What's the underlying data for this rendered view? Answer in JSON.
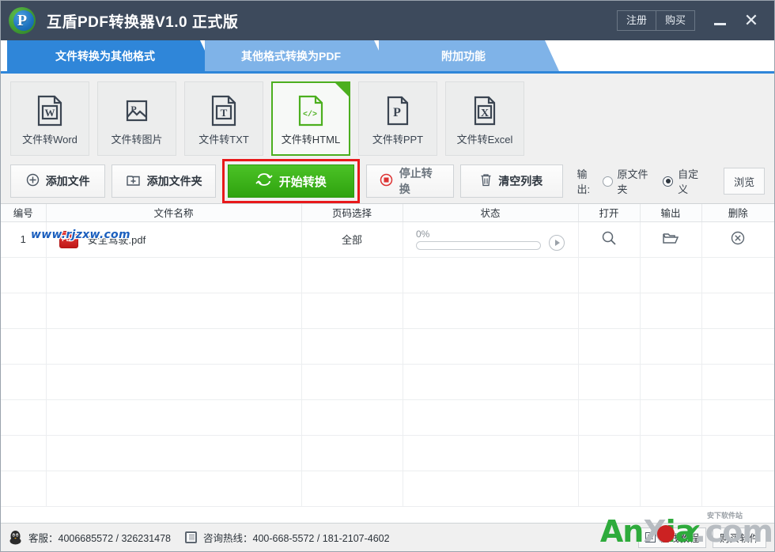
{
  "titlebar": {
    "app_title": "互盾PDF转换器V1.0 正式版",
    "logo_letter": "P",
    "register_label": "注册",
    "buy_label": "购买",
    "minimize_label": "—",
    "close_label": "✕"
  },
  "tabs": [
    {
      "label": "文件转换为其他格式",
      "active": true
    },
    {
      "label": "其他格式转换为PDF",
      "active": false
    },
    {
      "label": "附加功能",
      "active": false
    }
  ],
  "formats": [
    {
      "label": "文件转Word",
      "icon": "word-file-icon",
      "glyph": "W",
      "selected": false
    },
    {
      "label": "文件转图片",
      "icon": "image-file-icon",
      "glyph": "P",
      "selected": false
    },
    {
      "label": "文件转TXT",
      "icon": "txt-file-icon",
      "glyph": "T",
      "selected": false
    },
    {
      "label": "文件转HTML",
      "icon": "html-file-icon",
      "glyph": "</>",
      "selected": true
    },
    {
      "label": "文件转PPT",
      "icon": "ppt-file-icon",
      "glyph": "P",
      "selected": false
    },
    {
      "label": "文件转Excel",
      "icon": "excel-file-icon",
      "glyph": "X",
      "selected": false
    }
  ],
  "toolbar": {
    "add_file_label": "添加文件",
    "add_folder_label": "添加文件夹",
    "start_label": "开始转换",
    "stop_label": "停止转换",
    "clear_label": "清空列表",
    "output_label": "输出:",
    "output_option_source": "原文件夹",
    "output_option_custom": "自定义",
    "output_selected": "自定义",
    "browse_label": "浏览"
  },
  "watermark": {
    "site": "www.rjzxw.com",
    "brand_green": "An",
    "brand_gray_1": "X",
    "brand_gray_2": "ia",
    "brand_tail": ".com",
    "tiny_text": "安下软件站",
    "check": "✔"
  },
  "table": {
    "columns": [
      "编号",
      "文件名称",
      "页码选择",
      "状态",
      "打开",
      "输出",
      "删除"
    ],
    "rows": [
      {
        "index": "1",
        "filename": "安全驾驶.pdf",
        "file_type_badge": "PDF",
        "pages": "全部",
        "progress_text": "0%",
        "progress_value": 0,
        "open_icon": "search-icon",
        "output_icon": "folder-icon",
        "delete_icon": "close-circle-icon"
      }
    ],
    "empty_row_count": 7
  },
  "statusbar": {
    "support_label": "客服：4006685572 / 326231478",
    "hotline_label": "咨询热线：400-668-5572 / 181-2107-4602",
    "tutorial_label": "在线教程",
    "buy_software_label": "购买软件"
  },
  "colors": {
    "title_bar": "#3d4a5c",
    "tab_active": "#2f86d9",
    "tab_inactive": "#7fb3e8",
    "accent_green": "#4caf1f",
    "highlight_red": "#e8191b",
    "pdf_red": "#c01717"
  }
}
